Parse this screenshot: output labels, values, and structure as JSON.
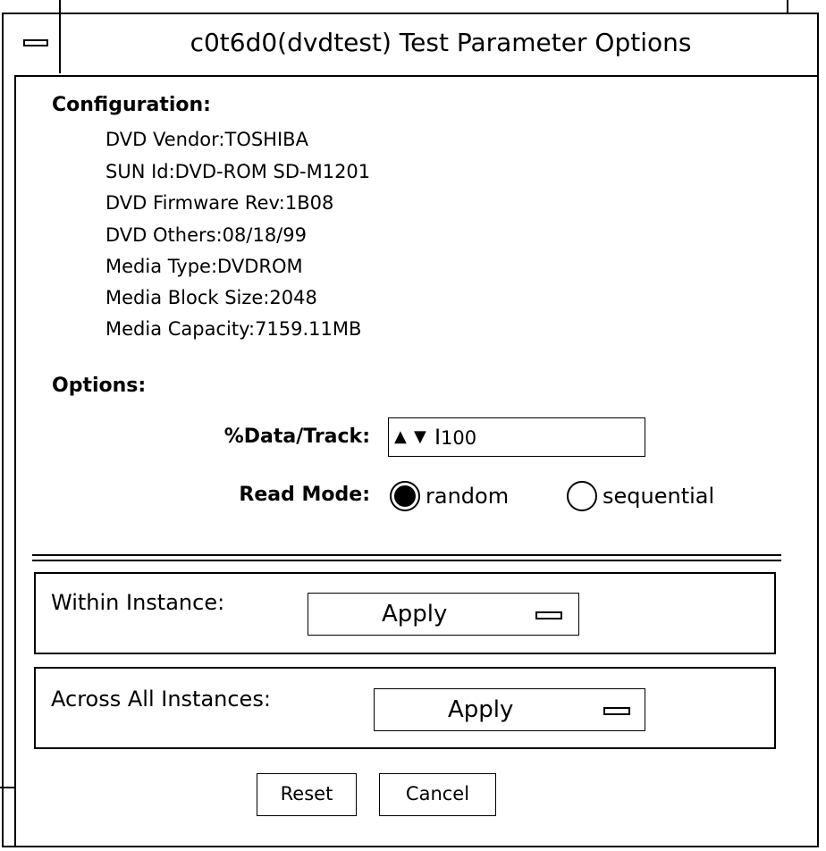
{
  "window": {
    "title": "c0t6d0(dvdtest) Test Parameter Options"
  },
  "configuration": {
    "heading": "Configuration:",
    "lines": [
      "DVD Vendor:TOSHIBA",
      "SUN Id:DVD-ROM SD-M1201",
      "DVD Firmware Rev:1B08",
      "DVD Others:08/18/99",
      "Media Type:DVDROM",
      "Media Block Size:2048",
      "Media Capacity:7159.11MB"
    ]
  },
  "options": {
    "heading": "Options:",
    "data_track": {
      "label": "%Data/Track:",
      "value": "100",
      "up_arrow": "▲",
      "down_arrow": "▼",
      "caret": "I"
    },
    "read_mode": {
      "label": "Read Mode:",
      "choices": [
        {
          "label": "random",
          "selected": true
        },
        {
          "label": "sequential",
          "selected": false
        }
      ]
    }
  },
  "within_instance": {
    "label": "Within Instance:",
    "button": "Apply",
    "icon": "menu-indicator-icon"
  },
  "across_instances": {
    "label": "Across All Instances:",
    "button": "Apply",
    "icon": "menu-indicator-icon"
  },
  "buttons": {
    "reset": "Reset",
    "cancel": "Cancel"
  }
}
